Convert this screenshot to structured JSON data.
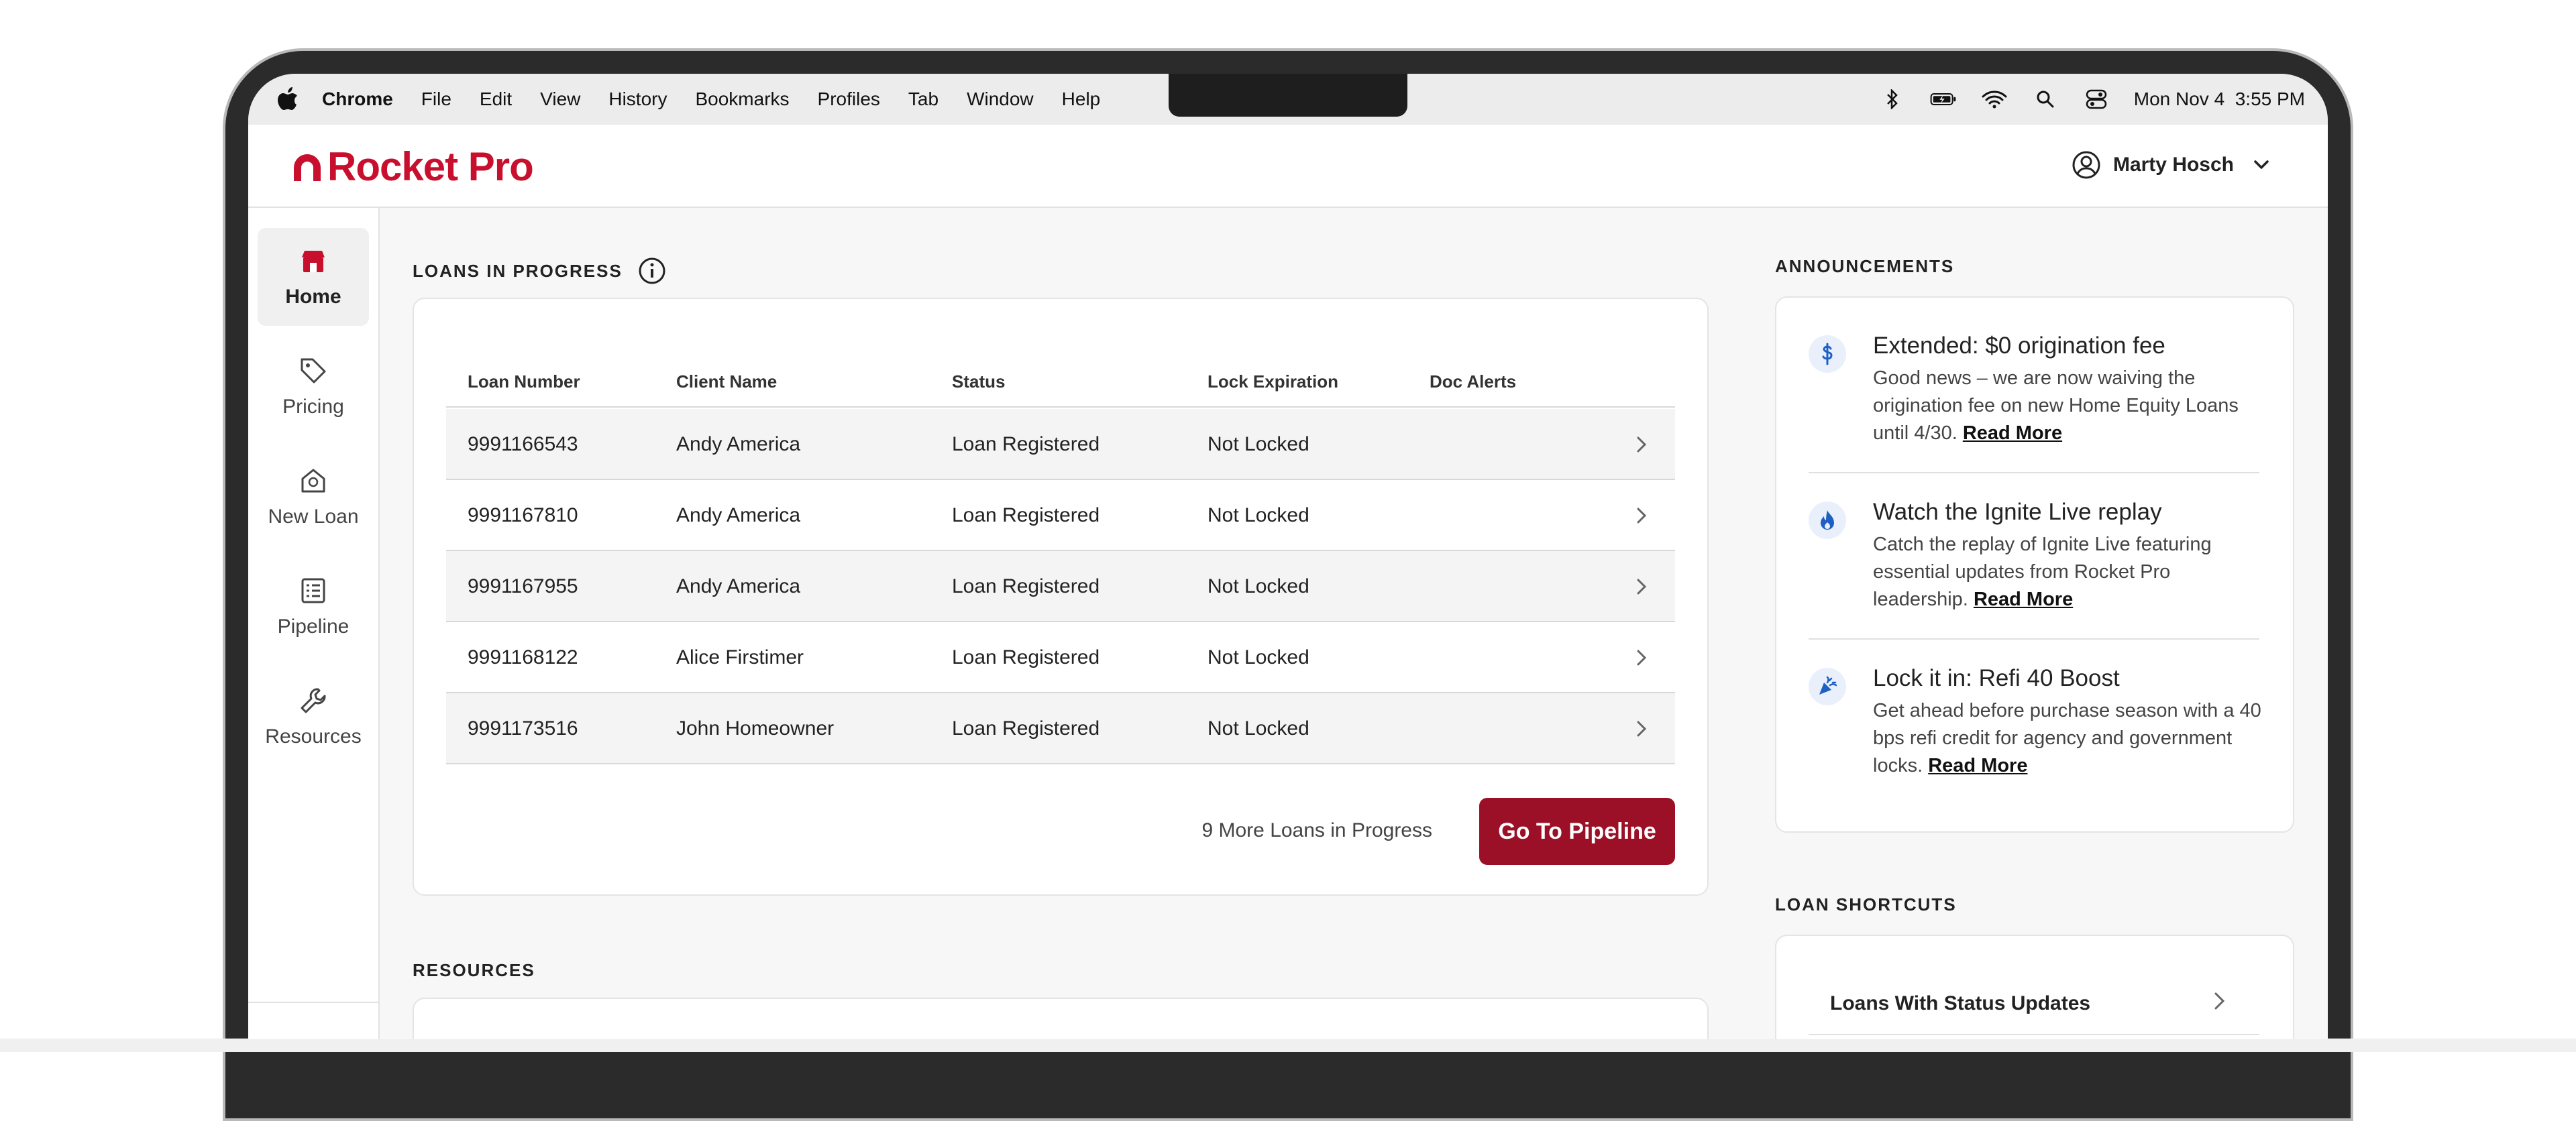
{
  "menubar": {
    "app": "Chrome",
    "items": [
      "File",
      "Edit",
      "View",
      "History",
      "Bookmarks",
      "Profiles",
      "Tab",
      "Window",
      "Help"
    ],
    "clock": "Mon Nov 4  3:55 PM"
  },
  "header": {
    "logo": "Rocket Pro",
    "user_name": "Marty Hosch"
  },
  "sidebar": {
    "items": [
      {
        "label": "Home",
        "icon": "store-icon",
        "active": true
      },
      {
        "label": "Pricing",
        "icon": "tag-icon"
      },
      {
        "label": "New Loan",
        "icon": "house-dollar-icon"
      },
      {
        "label": "Pipeline",
        "icon": "list-icon"
      },
      {
        "label": "Resources",
        "icon": "wrench-icon"
      }
    ]
  },
  "loans": {
    "section_title": "LOANS IN PROGRESS",
    "columns": [
      "Loan Number",
      "Client Name",
      "Status",
      "Lock Expiration",
      "Doc Alerts"
    ],
    "rows": [
      {
        "loan_number": "9991166543",
        "client": "Andy America",
        "status": "Loan Registered",
        "lock": "Not Locked"
      },
      {
        "loan_number": "9991167810",
        "client": "Andy America",
        "status": "Loan Registered",
        "lock": "Not Locked"
      },
      {
        "loan_number": "9991167955",
        "client": "Andy America",
        "status": "Loan Registered",
        "lock": "Not Locked"
      },
      {
        "loan_number": "9991168122",
        "client": "Alice Firstimer",
        "status": "Loan Registered",
        "lock": "Not Locked"
      },
      {
        "loan_number": "9991173516",
        "client": "John Homeowner",
        "status": "Loan Registered",
        "lock": "Not Locked"
      }
    ],
    "more_text": "9 More Loans in Progress",
    "button": "Go To Pipeline"
  },
  "resources": {
    "section_title": "RESOURCES"
  },
  "announcements": {
    "section_title": "ANNOUNCEMENTS",
    "items": [
      {
        "icon": "dollar-icon",
        "title": "Extended: $0 origination fee",
        "body": "Good news – we are now waiving the origination fee on new Home Equity Loans until 4/30.",
        "link": "Read More"
      },
      {
        "icon": "flame-icon",
        "title": "Watch the Ignite Live replay",
        "body": "Catch the replay of Ignite Live featuring essential updates from Rocket Pro leadership.",
        "link": "Read More"
      },
      {
        "icon": "party-popper-icon",
        "title": "Lock it in: Refi 40 Boost",
        "body": "Get ahead before purchase season with a 40 bps refi credit for agency and government locks.",
        "link": "Read More"
      }
    ]
  },
  "shortcuts": {
    "section_title": "LOAN SHORTCUTS",
    "items": [
      "Loans With Status Updates"
    ]
  },
  "colors": {
    "brand": "#c8102e",
    "button": "#9b1027",
    "icon_blue": "#1f5fc4"
  }
}
